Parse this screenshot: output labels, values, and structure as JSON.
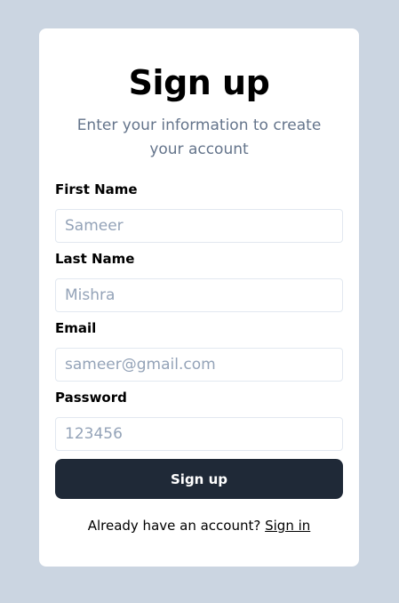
{
  "card": {
    "title": "Sign up",
    "subtitle": "Enter your information to create your account"
  },
  "fields": {
    "first_name": {
      "label": "First Name",
      "placeholder": "Sameer"
    },
    "last_name": {
      "label": "Last Name",
      "placeholder": "Mishra"
    },
    "email": {
      "label": "Email",
      "placeholder": "sameer@gmail.com"
    },
    "password": {
      "label": "Password",
      "placeholder": "123456"
    }
  },
  "submit_label": "Sign up",
  "footer": {
    "text": "Already have an account?",
    "link_label": "Sign in"
  },
  "colors": {
    "page_background": "#cbd5e1",
    "card_background": "#ffffff",
    "button_background": "#1f2937",
    "subtitle_text": "#64748b",
    "placeholder_text": "#94a3b8"
  }
}
